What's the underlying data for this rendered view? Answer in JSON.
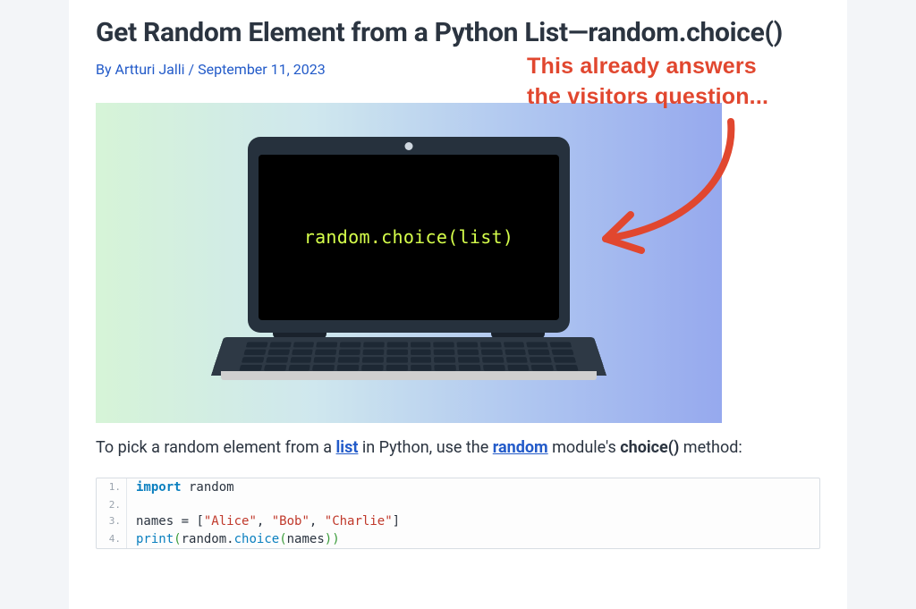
{
  "article": {
    "title": "Get Random Element from a Python List—random.choice()",
    "author": "Artturi Jalli",
    "date": "September 11, 2023",
    "byline_prefix": "By ",
    "byline_sep": " / "
  },
  "hero": {
    "code_on_screen": "random.choice(list)"
  },
  "annotation": {
    "line1": "This already answers",
    "line2": "the visitors question..."
  },
  "intro": {
    "seg1": "To pick a random element from a ",
    "link1_text": "list",
    "seg2": " in Python, use the ",
    "link2_text": "random",
    "seg3": " module's ",
    "bold_text": "choice()",
    "seg4": " method:"
  },
  "code": {
    "lines": [
      {
        "n": "1",
        "tokens": [
          [
            "kw",
            "import"
          ],
          [
            "plain",
            " random"
          ]
        ]
      },
      {
        "n": "2",
        "tokens": [
          [
            "plain",
            ""
          ]
        ]
      },
      {
        "n": "3",
        "tokens": [
          [
            "plain",
            "names "
          ],
          [
            "plain",
            "= "
          ],
          [
            "plain",
            "["
          ],
          [
            "str",
            "\"Alice\""
          ],
          [
            "plain",
            ", "
          ],
          [
            "str",
            "\"Bob\""
          ],
          [
            "plain",
            ", "
          ],
          [
            "str",
            "\"Charlie\""
          ],
          [
            "plain",
            "]"
          ]
        ]
      },
      {
        "n": "4",
        "tokens": [
          [
            "fn",
            "print"
          ],
          [
            "paren",
            "("
          ],
          [
            "plain",
            "random."
          ],
          [
            "fn",
            "choice"
          ],
          [
            "paren",
            "("
          ],
          [
            "plain",
            "names"
          ],
          [
            "paren",
            ")"
          ],
          [
            "paren",
            ")"
          ]
        ]
      }
    ]
  }
}
